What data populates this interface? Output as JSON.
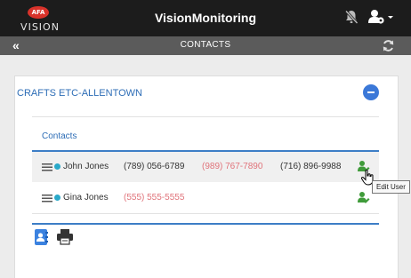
{
  "header": {
    "logo_badge": "AFA",
    "logo_text": "VISION",
    "title": "VisionMonitoring"
  },
  "subheader": {
    "title": "CONTACTS"
  },
  "account": {
    "name": "CRAFTS ETC-ALLENTOWN"
  },
  "contacts": {
    "title": "Contacts",
    "rows": [
      {
        "name": "John Jones",
        "phone1": "(789) 056-6789",
        "phone2": "(989) 767-7890",
        "phone3": "(716) 896-9988"
      },
      {
        "name": "Gina Jones",
        "phone1": "(555) 555-5555"
      }
    ]
  },
  "tooltip": "Edit User",
  "colors": {
    "header_bg": "#1c1c1c",
    "subheader_bg": "#5b5b5b",
    "accent_blue": "#3d7ec6",
    "link_blue": "#2d6db6",
    "phone_red": "#e0737a",
    "status_dot": "#2aa9c9",
    "edit_green": "#3f9b3a"
  },
  "icons": {
    "header_alarm_off": "bell-slash-icon",
    "header_user_settings": "user-gear-icon",
    "refresh": "refresh-icon",
    "back": "double-chevron-left-icon",
    "edit_user": "user-edit-icon",
    "address_book": "address-book-icon",
    "print": "printer-icon"
  }
}
